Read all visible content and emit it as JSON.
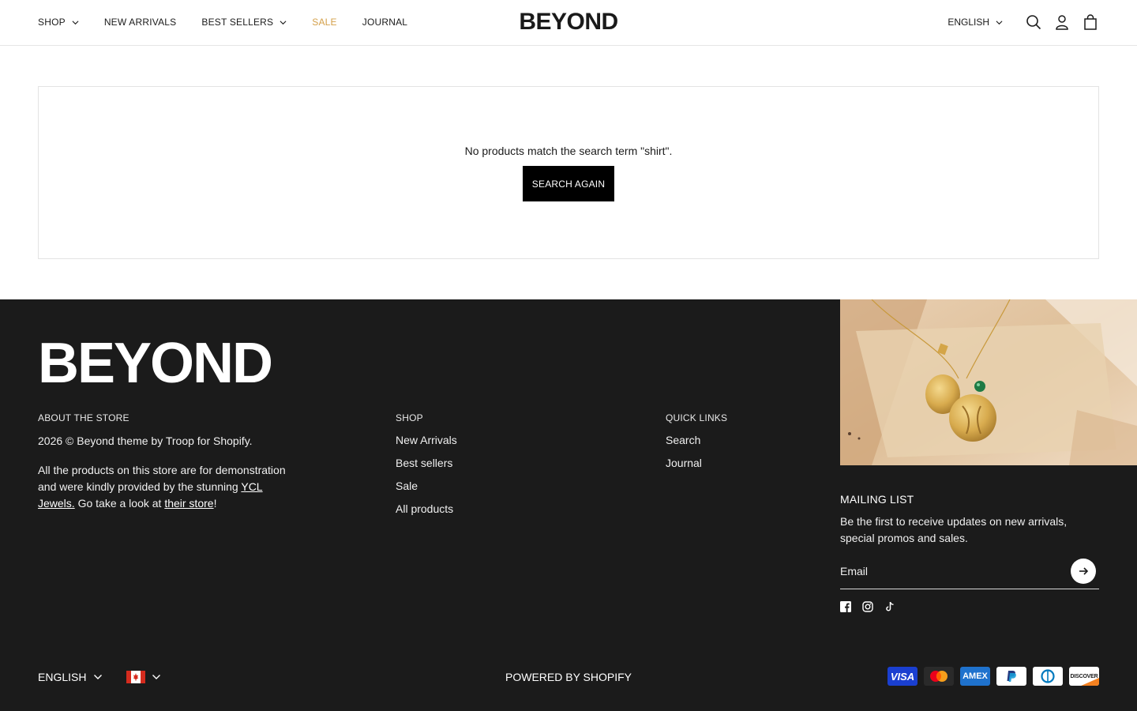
{
  "header": {
    "logo": "BEYOND",
    "nav": [
      {
        "label": "SHOP",
        "has_dropdown": true
      },
      {
        "label": "NEW ARRIVALS",
        "has_dropdown": false
      },
      {
        "label": "BEST SELLERS",
        "has_dropdown": true
      },
      {
        "label": "SALE",
        "has_dropdown": false
      },
      {
        "label": "JOURNAL",
        "has_dropdown": false
      }
    ],
    "language": "ENGLISH",
    "icons": [
      "search-icon",
      "account-icon",
      "cart-icon"
    ]
  },
  "search_results": {
    "message": "No products match the search term \"shirt\".",
    "button_label": "SEARCH AGAIN"
  },
  "footer": {
    "logo": "BEYOND",
    "about": {
      "heading": "ABOUT THE STORE",
      "copyright": "2026 © Beyond theme by Troop for Shopify.",
      "text_before": "All the products on this store are for demonstration and were kindly provided by the stunning ",
      "link1": "YCL Jewels.",
      "text_middle": " Go take a look at ",
      "link2": "their store",
      "text_after": "!"
    },
    "shop": {
      "heading": "SHOP",
      "links": [
        "New Arrivals",
        "Best sellers",
        "Sale",
        "All products"
      ]
    },
    "quick_links": {
      "heading": "QUICK LINKS",
      "links": [
        "Search",
        "Journal"
      ]
    },
    "mailing": {
      "heading": "MAILING LIST",
      "description": "Be the first to receive updates on new arrivals, special promos and sales.",
      "email_placeholder": "Email"
    },
    "social": [
      "facebook-icon",
      "instagram-icon",
      "tiktok-icon"
    ],
    "bottom": {
      "language": "ENGLISH",
      "country_flag": "canada-flag-icon",
      "powered_by": "POWERED BY SHOPIFY"
    },
    "payments": [
      "VISA",
      "Mastercard",
      "AMEX",
      "PayPal",
      "Diners Club",
      "DISCOVER"
    ]
  },
  "colors": {
    "sale": "#d4a04a",
    "footer_bg": "#1b1b1b",
    "button_bg": "#000000"
  }
}
